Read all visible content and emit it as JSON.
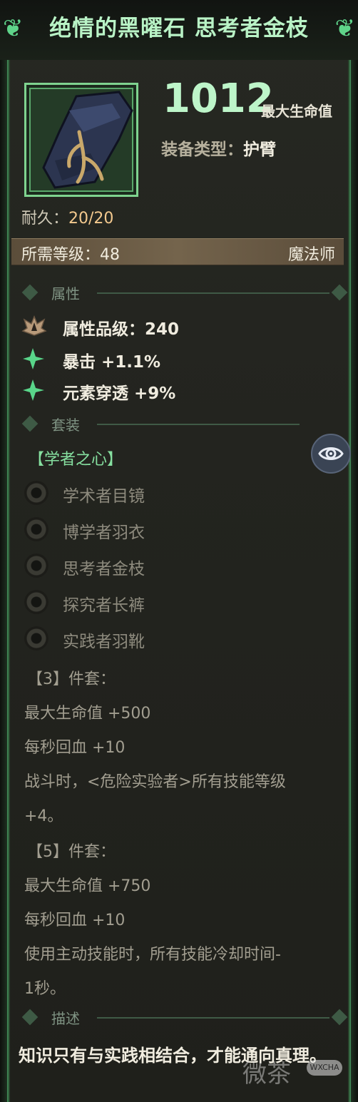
{
  "item": {
    "title": "绝情的黑曜石 思考者金枝",
    "main_stat_value": "1012",
    "main_stat_label": "最大生命值",
    "type_label": "装备类型：",
    "type_value": "护臂",
    "durability_label": "耐久：",
    "durability_value": "20/20",
    "required_level_label": "所需等级：48",
    "class": "魔法师",
    "icon": "dark-bracer-with-golden-branch-icon"
  },
  "sections": {
    "attributes": "属性",
    "set": "套装",
    "description": "描述"
  },
  "attributes": [
    {
      "icon": "lotus-crest-icon",
      "text": "属性品级：240"
    },
    {
      "icon": "green-sparkle-icon",
      "text": "暴击 +1.1%"
    },
    {
      "icon": "green-sparkle-icon",
      "text": "元素穿透 +9%"
    }
  ],
  "set": {
    "name": "【学者之心】",
    "items": [
      "学术者目镜",
      "博学者羽衣",
      "思考者金枝",
      "探究者长裤",
      "实践者羽靴"
    ],
    "bonus3": {
      "head": "【3】件套：",
      "lines": [
        "最大生命值 +500",
        "每秒回血 +10",
        "战斗时，<危险实验者>所有技能等级",
        "+4。"
      ]
    },
    "bonus5": {
      "head": "【5】件套：",
      "lines": [
        "最大生命值 +750",
        "每秒回血 +10",
        "使用主动技能时，所有技能冷却时间-",
        "1秒。"
      ]
    }
  },
  "description_text": "知识只有与实践相结合，才能通向真理。",
  "watermark": {
    "text": "微茶",
    "badge": "WXCHA"
  },
  "colors": {
    "accent_green": "#86e0a0",
    "title_green": "#b9f3c6",
    "durability": "#f3c98e"
  }
}
